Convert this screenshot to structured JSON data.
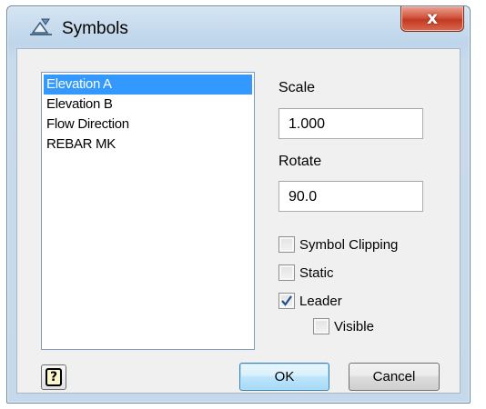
{
  "window": {
    "title": "Symbols",
    "close_glyph": "x",
    "icon": "symbol-app-icon"
  },
  "list": {
    "items": [
      "Elevation A",
      "Elevation B",
      "Flow Direction",
      "REBAR MK"
    ],
    "selected_index": 0
  },
  "scale": {
    "label": "Scale",
    "value": "1.000"
  },
  "rotate": {
    "label": "Rotate",
    "value": "90.0"
  },
  "options": {
    "symbol_clipping": {
      "label": "Symbol Clipping",
      "checked": false
    },
    "static": {
      "label": "Static",
      "checked": false
    },
    "leader": {
      "label": "Leader",
      "checked": true
    },
    "visible": {
      "label": "Visible",
      "checked": false
    }
  },
  "buttons": {
    "help": "?",
    "ok": "OK",
    "cancel": "Cancel"
  },
  "colors": {
    "selection": "#3399ff",
    "title_bar": "#bed5ea",
    "close_button": "#c23a22",
    "dialog_bg": "#f0f0f0"
  }
}
